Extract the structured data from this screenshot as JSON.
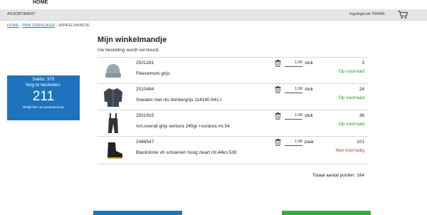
{
  "topbar": {
    "home": "HOME"
  },
  "navbar": {
    "assortiment": "ASSORTIMENT",
    "login": "Ingelogd als 706400.",
    "cart_icon": "cart-icon"
  },
  "breadcrumb": {
    "home": "HOME",
    "sep1": " - ",
    "pbm": "PBM GEBRUIKER",
    "sep2": " - ",
    "current": "WINKELMANDJE"
  },
  "saldo": {
    "line1": "Saldo: 375",
    "line2": "Nog te besteden:",
    "amount": "211",
    "link": "Bekijk hier uw puntenverloop"
  },
  "page": {
    "title": "Mijn winkelmandje",
    "subtitle": "Uw bestelling wordt verstuurd."
  },
  "items": [
    {
      "code": "2501281",
      "desc": "Fleecemuts grijs",
      "qty": "1.00",
      "unit": "stuk",
      "points": "3",
      "status": "Op voorraad",
      "status_color": "#2e9a2e",
      "icon": "beanie-icon"
    },
    {
      "code": "2510484",
      "desc": "Sweater met rits donkergrijs 114140-941-l",
      "qty": "1.00",
      "unit": "stuk",
      "points": "24",
      "status": "Op voorraad",
      "status_color": "#2e9a2e",
      "icon": "sweater-icon"
    },
    {
      "code": "2501915",
      "desc": "Am.overall grijs ventura 245gr.+cordura mt.54",
      "qty": "1.00",
      "unit": "stuk",
      "points": "36",
      "status": "Op voorraad",
      "status_color": "#2e9a2e",
      "icon": "overall-icon"
    },
    {
      "code": "2486547",
      "desc": "Blackstone vh schoenen hoog zwart mt.44kn 530",
      "qty": "1.00",
      "unit": "paar",
      "points": "101",
      "status": "Niet voorradig",
      "status_color": "#c0392b",
      "icon": "boot-icon"
    }
  ],
  "total": "Totaal aantal punten: 164",
  "colors": {
    "accent": "#1e73be",
    "ok": "#2e9a2e",
    "nok": "#c0392b",
    "green_button": "#2fae3b"
  }
}
